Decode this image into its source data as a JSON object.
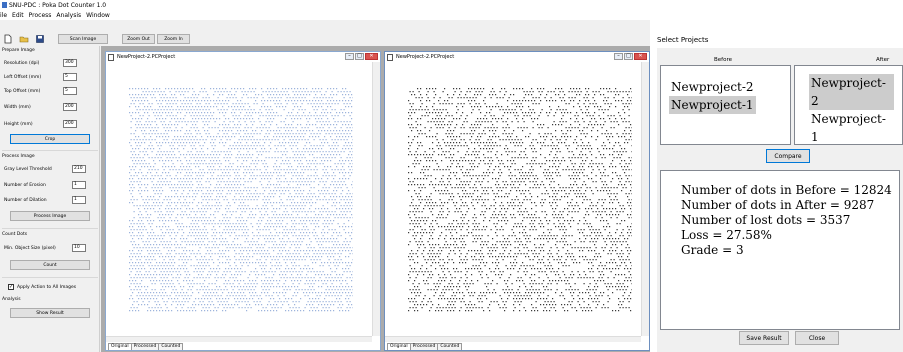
{
  "app": {
    "title": "SNU-PDC : Poka Dot Counter 1.0",
    "menu": [
      "ile",
      "Edit",
      "Process",
      "Analysis",
      "Window"
    ],
    "toolbar": {
      "icons": [
        "new-file-icon",
        "open-folder-icon",
        "save-disk-icon"
      ],
      "scan_image": "Scan Image",
      "zoom_out": "Zoom Out",
      "zoom_in": "Zoom In"
    }
  },
  "panel": {
    "prepare": {
      "title": "Prepare Image",
      "fields": [
        {
          "label": "Resolution (dpi)",
          "value": "300"
        },
        {
          "label": "Left Offset (mm)",
          "value": "5"
        },
        {
          "label": "Top Offset (mm)",
          "value": "5"
        },
        {
          "label": "Width (mm)",
          "value": "200"
        },
        {
          "label": "Height (mm)",
          "value": "200"
        }
      ],
      "crop": "Crop"
    },
    "process": {
      "title": "Process Image",
      "fields": [
        {
          "label": "Gray Level Threshold",
          "value": "210"
        },
        {
          "label": "Number of Erosion",
          "value": "1"
        },
        {
          "label": "Number of Dilation",
          "value": "1"
        }
      ],
      "button": "Process Image"
    },
    "count": {
      "title": "Count Dots",
      "fields": [
        {
          "label": "Min. Object Size (pixel)",
          "value": "10"
        }
      ],
      "button": "Count"
    },
    "apply_all": {
      "label": "Apply Action to All Images",
      "checked": true
    },
    "analysis": {
      "title": "Analysis",
      "button": "Show Result"
    }
  },
  "children": [
    {
      "title": "NewProject-2.PCProject",
      "tabs": [
        "Original",
        "Processed",
        "Counted"
      ],
      "selected_tab": 0,
      "dot_color": "#9db4dc"
    },
    {
      "title": "NewProject-2.PCProject",
      "tabs": [
        "Original",
        "Processed",
        "Counted"
      ],
      "selected_tab": 0,
      "dot_color": "#3a3a3a"
    }
  ],
  "dialog": {
    "title": "Select Projects",
    "before": {
      "header": "Before",
      "items": [
        "Newproject-2",
        "Newproject-1"
      ],
      "selected": 1
    },
    "after": {
      "header": "After",
      "items": [
        "Newproject-2",
        "Newproject-1"
      ],
      "selected": 0
    },
    "compare": "Compare",
    "results": [
      "Number of dots in Before = 12824",
      "Number of dots in After = 9287",
      "Number of lost dots = 3537",
      "Loss = 27.58%",
      "Grade = 3"
    ],
    "save_result": "Save Result",
    "close": "Close"
  }
}
